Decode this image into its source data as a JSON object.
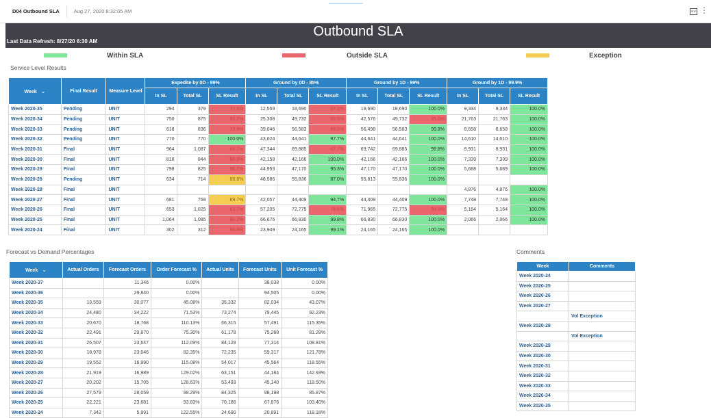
{
  "topbar": {
    "report_name": "D04 Outbound SLA",
    "timestamp": "Aug 27, 2020 8:32:05 AM",
    "pdf_label": "PDF"
  },
  "header": {
    "title": "Outbound SLA",
    "refresh": "Last Data Refresh: 8/27/20 6:30 AM"
  },
  "legend": {
    "within": {
      "label": "Within SLA",
      "color": "#7ee59a"
    },
    "outside": {
      "label": "Outside SLA",
      "color": "#e8666c"
    },
    "exception": {
      "label": "Exception",
      "color": "#f4cd52"
    }
  },
  "sla": {
    "section_title": "Service Level Results",
    "groups": [
      "Expedite by 0D - 99%",
      "Ground by 0D - 85%",
      "Ground by 1D - 99%",
      "Ground by 1D - 99.9%"
    ],
    "col_week": "Week",
    "col_final": "Final Result",
    "col_measure": "Measure Level",
    "sub": [
      "In SL",
      "Total SL",
      "SL Result"
    ],
    "rows": [
      {
        "week": "Week 2020-35",
        "final": "Pending",
        "measure": "UNIT",
        "g": [
          [
            "294",
            "379",
            "77.6%",
            "r"
          ],
          [
            "12,559",
            "18,690",
            "67.2%",
            "r"
          ],
          [
            "18,690",
            "18,690",
            "100.0%",
            "g"
          ],
          [
            "9,334",
            "9,334",
            "100.0%",
            "g"
          ]
        ]
      },
      {
        "week": "Week 2020-34",
        "final": "Pending",
        "measure": "UNIT",
        "g": [
          [
            "750",
            "875",
            "85.7%",
            "r"
          ],
          [
            "25,308",
            "49,732",
            "50.9%",
            "r"
          ],
          [
            "42,576",
            "49,732",
            "85.6%",
            "r"
          ],
          [
            "21,763",
            "21,763",
            "100.0%",
            "g"
          ]
        ]
      },
      {
        "week": "Week 2020-33",
        "final": "Pending",
        "measure": "UNIT",
        "g": [
          [
            "618",
            "836",
            "73.9%",
            "r"
          ],
          [
            "39,046",
            "56,583",
            "69.0%",
            "r"
          ],
          [
            "56,498",
            "56,583",
            "99.8%",
            "g"
          ],
          [
            "8,658",
            "8,658",
            "100.0%",
            "g"
          ]
        ]
      },
      {
        "week": "Week 2020-32",
        "final": "Pending",
        "measure": "UNIT",
        "g": [
          [
            "770",
            "770",
            "100.0%",
            "g"
          ],
          [
            "43,624",
            "44,641",
            "97.7%",
            "g"
          ],
          [
            "44,641",
            "44,641",
            "100.0%",
            "g"
          ],
          [
            "14,610",
            "14,610",
            "100.0%",
            "g"
          ]
        ]
      },
      {
        "week": "Week 2020-31",
        "final": "Final",
        "measure": "UNIT",
        "g": [
          [
            "964",
            "1,087",
            "88.7%",
            "r"
          ],
          [
            "47,344",
            "69,885",
            "67.7%",
            "r"
          ],
          [
            "69,742",
            "69,885",
            "99.8%",
            "g"
          ],
          [
            "8,931",
            "8,931",
            "100.0%",
            "g"
          ]
        ]
      },
      {
        "week": "Week 2020-30",
        "final": "Final",
        "measure": "UNIT",
        "g": [
          [
            "818",
            "844",
            "96.9%",
            "r"
          ],
          [
            "42,158",
            "42,166",
            "100.0%",
            "g"
          ],
          [
            "42,166",
            "42,166",
            "100.0%",
            "g"
          ],
          [
            "7,339",
            "7,339",
            "100.0%",
            "g"
          ]
        ]
      },
      {
        "week": "Week 2020-29",
        "final": "Final",
        "measure": "UNIT",
        "g": [
          [
            "798",
            "825",
            "96.7%",
            "r"
          ],
          [
            "44,953",
            "47,170",
            "95.3%",
            "g"
          ],
          [
            "47,170",
            "47,170",
            "100.0%",
            "g"
          ],
          [
            "5,688",
            "5,689",
            "100.0%",
            "g"
          ]
        ]
      },
      {
        "week": "Week 2020-28",
        "final": "Pending",
        "measure": "UNIT",
        "g": [
          [
            "634",
            "714",
            "88.8%",
            "y"
          ],
          [
            "48,586",
            "55,836",
            "87.0%",
            "g"
          ],
          [
            "55,813",
            "55,836",
            "100.0%",
            "g"
          ],
          [
            "",
            "",
            "",
            ""
          ]
        ]
      },
      {
        "week": "Week 2020-28",
        "final": "Final",
        "measure": "UNIT",
        "g": [
          [
            "",
            "",
            "",
            ""
          ],
          [
            "",
            "",
            "",
            ""
          ],
          [
            "",
            "",
            "",
            ""
          ],
          [
            "4,876",
            "4,876",
            "100.0%",
            "g"
          ]
        ]
      },
      {
        "week": "Week 2020-27",
        "final": "Final",
        "measure": "UNIT",
        "g": [
          [
            "681",
            "759",
            "89.7%",
            "y"
          ],
          [
            "42,057",
            "44,409",
            "94.7%",
            "g"
          ],
          [
            "44,409",
            "44,409",
            "100.0%",
            "g"
          ],
          [
            "7,748",
            "7,748",
            "100.0%",
            "g"
          ]
        ]
      },
      {
        "week": "Week 2020-26",
        "final": "Final",
        "measure": "UNIT",
        "g": [
          [
            "653",
            "1,025",
            "63.7%",
            "r"
          ],
          [
            "57,205",
            "72,775",
            "78.6%",
            "r"
          ],
          [
            "71,965",
            "72,775",
            "98.9%",
            "r"
          ],
          [
            "5,164",
            "5,164",
            "100.0%",
            "g"
          ]
        ]
      },
      {
        "week": "Week 2020-25",
        "final": "Final",
        "measure": "UNIT",
        "g": [
          [
            "1,064",
            "1,085",
            "98.1%",
            "r"
          ],
          [
            "66,676",
            "66,830",
            "99.8%",
            "g"
          ],
          [
            "66,830",
            "66,830",
            "100.0%",
            "g"
          ],
          [
            "2,066",
            "2,066",
            "100.0%",
            "g"
          ]
        ]
      },
      {
        "week": "Week 2020-24",
        "final": "Final",
        "measure": "UNIT",
        "g": [
          [
            "302",
            "312",
            "96.8%",
            "r"
          ],
          [
            "23,949",
            "24,165",
            "99.1%",
            "g"
          ],
          [
            "24,165",
            "24,165",
            "100.0%",
            "g"
          ],
          [
            "",
            "",
            "",
            ""
          ]
        ]
      }
    ]
  },
  "forecast": {
    "section_title": "Forecast vs Demand Percentages",
    "headers": [
      "Week",
      "Actual Orders",
      "Forecast Orders",
      "Order Forecast %",
      "Actual Units",
      "Forecast Units",
      "Unit Forecast %"
    ],
    "rows": [
      [
        "Week 2020-37",
        "",
        "11,346",
        "0.00%",
        "",
        "38,038",
        "0.00%"
      ],
      [
        "Week 2020-36",
        "",
        "29,840",
        "0.00%",
        "",
        "94,505",
        "0.00%"
      ],
      [
        "Week 2020-35",
        "13,559",
        "30,077",
        "45.08%",
        "35,332",
        "82,034",
        "43.07%"
      ],
      [
        "Week 2020-34",
        "24,480",
        "34,222",
        "71.53%",
        "73,274",
        "79,445",
        "92.23%"
      ],
      [
        "Week 2020-33",
        "20,670",
        "18,768",
        "110.13%",
        "66,315",
        "57,491",
        "115.35%"
      ],
      [
        "Week 2020-32",
        "22,491",
        "29,870",
        "75.30%",
        "61,178",
        "75,268",
        "81.28%"
      ],
      [
        "Week 2020-31",
        "26,507",
        "23,647",
        "112.09%",
        "84,128",
        "77,314",
        "108.81%"
      ],
      [
        "Week 2020-30",
        "18,978",
        "23,046",
        "82.35%",
        "72,235",
        "59,317",
        "121.78%"
      ],
      [
        "Week 2020-29",
        "19,552",
        "16,990",
        "115.08%",
        "54,017",
        "45,564",
        "118.55%"
      ],
      [
        "Week 2020-28",
        "21,919",
        "16,989",
        "129.02%",
        "63,151",
        "44,184",
        "142.93%"
      ],
      [
        "Week 2020-27",
        "20,202",
        "15,705",
        "128.63%",
        "53,493",
        "45,140",
        "118.50%"
      ],
      [
        "Week 2020-26",
        "27,579",
        "28,059",
        "98.29%",
        "84,325",
        "98,198",
        "85.87%"
      ],
      [
        "Week 2020-25",
        "22,221",
        "23,681",
        "93.83%",
        "70,186",
        "67,876",
        "103.40%"
      ],
      [
        "Week 2020-24",
        "7,342",
        "5,991",
        "122.55%",
        "24,690",
        "20,891",
        "118.18%"
      ]
    ]
  },
  "comments": {
    "section_title": "Comments",
    "headers": [
      "Week",
      "Comments"
    ],
    "rows": [
      {
        "week": "Week 2020-24",
        "comment": ""
      },
      {
        "week": "Week 2020-25",
        "comment": ""
      },
      {
        "week": "Week 2020-26",
        "comment": ""
      },
      {
        "week": "Week 2020-27",
        "comment": "Vol Exception"
      },
      {
        "week": "Week 2020-28",
        "comment": "Vol Exception"
      },
      {
        "week": "Week 2020-29",
        "comment": ""
      },
      {
        "week": "Week 2020-30",
        "comment": ""
      },
      {
        "week": "Week 2020-31",
        "comment": ""
      },
      {
        "week": "Week 2020-32",
        "comment": ""
      },
      {
        "week": "Week 2020-33",
        "comment": ""
      },
      {
        "week": "Week 2020-34",
        "comment": ""
      },
      {
        "week": "Week 2020-35",
        "comment": ""
      }
    ]
  }
}
